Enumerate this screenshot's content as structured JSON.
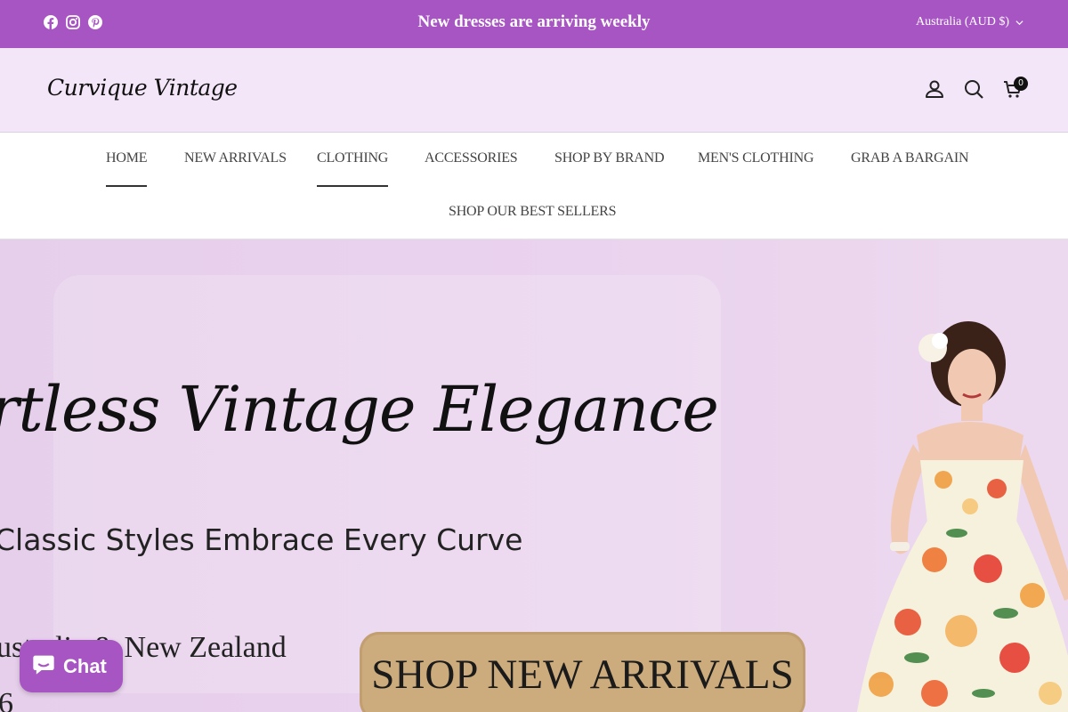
{
  "announcement": {
    "text": "New dresses are arriving weekly",
    "social_icons": [
      "facebook-icon",
      "instagram-icon",
      "pinterest-icon"
    ],
    "country_selector": "Australia (AUD $)"
  },
  "header": {
    "logo": "Curvique Vintage",
    "icons": [
      "account-icon",
      "search-icon",
      "cart-icon"
    ],
    "cart_count": "0"
  },
  "nav": {
    "items": [
      {
        "label": "HOME"
      },
      {
        "label": "NEW ARRIVALS"
      },
      {
        "label": "CLOTHING"
      },
      {
        "label": "ACCESSORIES"
      },
      {
        "label": "SHOP BY BRAND"
      },
      {
        "label": "MEN'S CLOTHING"
      },
      {
        "label": "GRAB A BARGAIN"
      },
      {
        "label": "SHOP OUR BEST SELLERS"
      }
    ]
  },
  "hero": {
    "title": "rtless Vintage Elegance",
    "subtitle": "Classic Styles Embrace Every Curve",
    "region": "ustralia & New Zealand",
    "year": "6",
    "button": "SHOP NEW ARRIVALS"
  },
  "chat": {
    "label": "Chat"
  },
  "colors": {
    "accent": "#a855c4",
    "header_bg": "#f3e6f8",
    "hero_bg": "#e9d2ee",
    "button_bg": "#ccab7c"
  }
}
